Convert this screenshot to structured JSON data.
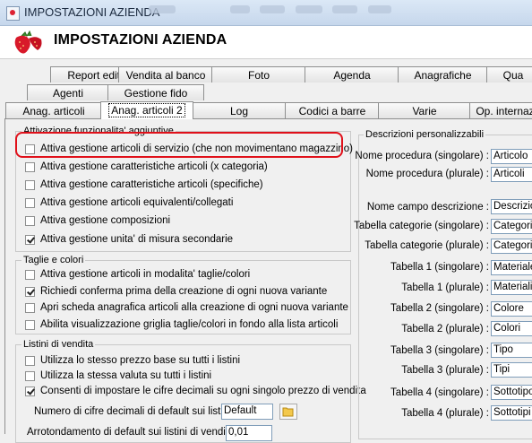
{
  "window": {
    "title": "IMPOSTAZIONI AZIENDA"
  },
  "header": {
    "title": "IMPOSTAZIONI AZIENDA"
  },
  "tabs": {
    "row1": [
      "Report editor",
      "Vendita al banco",
      "Foto",
      "Agenda",
      "Anagrafiche",
      "Qua"
    ],
    "row2": [
      "Agenti",
      "Gestione fido"
    ],
    "row3": [
      "Anag. articoli",
      "Anag. articoli 2",
      "Log",
      "Codici a barre",
      "Varie",
      "Op. internaz"
    ],
    "active": "Anag. articoli 2"
  },
  "group_attivazione": {
    "label": "Attivazione funzionalita' aggiuntive",
    "items": [
      {
        "label": "Attiva gestione articoli di servizio (che non movimentano magazzino)",
        "checked": false
      },
      {
        "label": "Attiva gestione caratteristiche articoli (x categoria)",
        "checked": false
      },
      {
        "label": "Attiva gestione caratteristiche articoli (specifiche)",
        "checked": false
      },
      {
        "label": "Attiva gestione articoli equivalenti/collegati",
        "checked": false
      },
      {
        "label": "Attiva gestione composizioni",
        "checked": false
      },
      {
        "label": "Attiva gestione unita' di misura secondarie",
        "checked": true
      }
    ]
  },
  "group_taglie": {
    "label": "Taglie e colori",
    "items": [
      {
        "label": "Attiva gestione articoli in modalita' taglie/colori",
        "checked": false
      },
      {
        "label": "Richiedi conferma prima della creazione di ogni nuova variante",
        "checked": true
      },
      {
        "label": "Apri scheda anagrafica articoli alla creazione di ogni nuova variante",
        "checked": false
      },
      {
        "label": "Abilita visualizzazione griglia taglie/colori in fondo alla lista articoli",
        "checked": false
      }
    ]
  },
  "group_listini": {
    "label": "Listini di vendita",
    "items": [
      {
        "label": "Utilizza lo stesso prezzo base su tutti i listini",
        "checked": false
      },
      {
        "label": "Utilizza la stessa valuta su tutti i listini",
        "checked": false
      },
      {
        "label": "Consenti di impostare le cifre decimali su ogni singolo prezzo di vendita",
        "checked": true
      }
    ],
    "decimali_label": "Numero di cifre decimali di default sui listini :",
    "decimali_value": "Default",
    "arrotondamento_label": "Arrotondamento di default sui listini di vendita :",
    "arrotondamento_value": "0,01"
  },
  "group_descrizioni": {
    "label": "Descrizioni personalizzabili",
    "fields": [
      {
        "label": "Nome procedura (singolare) :",
        "value": "Articolo"
      },
      {
        "label": "Nome procedura (plurale) :",
        "value": "Articoli"
      },
      {
        "label": "Nome campo descrizione :",
        "value": "Descrizio"
      },
      {
        "label": "Tabella categorie (singolare) :",
        "value": "Categoria"
      },
      {
        "label": "Tabella categorie (plurale) :",
        "value": "Categorie"
      },
      {
        "label": "Tabella 1 (singolare) :",
        "value": "Materiale"
      },
      {
        "label": "Tabella 1 (plurale) :",
        "value": "Materiali"
      },
      {
        "label": "Tabella 2 (singolare) :",
        "value": "Colore"
      },
      {
        "label": "Tabella 2 (plurale) :",
        "value": "Colori"
      },
      {
        "label": "Tabella 3 (singolare) :",
        "value": "Tipo"
      },
      {
        "label": "Tabella 3 (plurale) :",
        "value": "Tipi"
      },
      {
        "label": "Tabella 4 (singolare) :",
        "value": "Sottotipo"
      },
      {
        "label": "Tabella 4 (plurale) :",
        "value": "Sottotipi"
      }
    ]
  }
}
